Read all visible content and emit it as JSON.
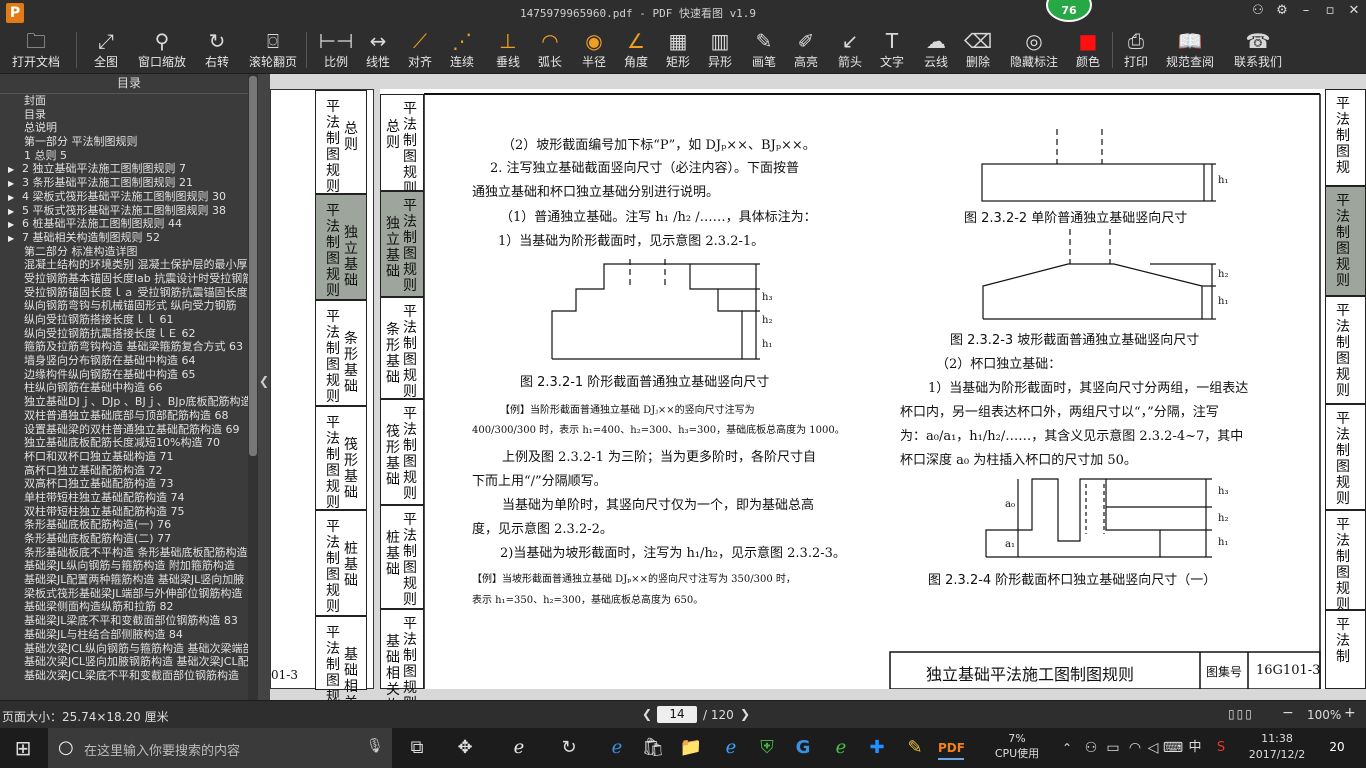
{
  "window": {
    "title": "1475979965960.pdf - PDF 快速看图 v1.9",
    "badge": "76",
    "logo": "P"
  },
  "toolbar": [
    {
      "label": "打开文档",
      "icon": "folder-icon"
    },
    {
      "label": "全图",
      "icon": "fullview-icon"
    },
    {
      "label": "窗口缩放",
      "icon": "zoom-icon"
    },
    {
      "label": "右转",
      "icon": "rotate-icon"
    },
    {
      "label": "滚轮翻页",
      "icon": "mouse-icon"
    },
    {
      "label": "比例",
      "icon": "scale-icon"
    },
    {
      "label": "线性",
      "icon": "linear-icon"
    },
    {
      "label": "对齐",
      "icon": "align-icon"
    },
    {
      "label": "连续",
      "icon": "continuous-icon"
    },
    {
      "label": "垂线",
      "icon": "perpendicular-icon"
    },
    {
      "label": "弧长",
      "icon": "arc-icon"
    },
    {
      "label": "半径",
      "icon": "radius-icon"
    },
    {
      "label": "角度",
      "icon": "angle-icon"
    },
    {
      "label": "矩形",
      "icon": "rectangle-icon"
    },
    {
      "label": "异形",
      "icon": "polygon-icon"
    },
    {
      "label": "画笔",
      "icon": "pen-icon"
    },
    {
      "label": "高亮",
      "icon": "highlight-icon"
    },
    {
      "label": "箭头",
      "icon": "arrow-icon"
    },
    {
      "label": "文字",
      "icon": "text-icon"
    },
    {
      "label": "云线",
      "icon": "cloud-icon"
    },
    {
      "label": "删除",
      "icon": "eraser-icon"
    },
    {
      "label": "隐藏标注",
      "icon": "eye-hide-icon"
    },
    {
      "label": "颜色",
      "icon": "color-icon"
    },
    {
      "label": "打印",
      "icon": "print-icon"
    },
    {
      "label": "规范查阅",
      "icon": "book-icon"
    },
    {
      "label": "联系我们",
      "icon": "contact-icon"
    }
  ],
  "sidebar": {
    "header": "目录",
    "items": [
      {
        "t": "封面",
        "l": 0,
        "a": false
      },
      {
        "t": "目录",
        "l": 0,
        "a": false
      },
      {
        "t": "总说明",
        "l": 0,
        "a": false
      },
      {
        "t": "第一部分  平法制图规则",
        "l": 0,
        "a": false
      },
      {
        "t": "1 总则 5",
        "l": 0,
        "a": false
      },
      {
        "t": "2 独立基础平法施工图制图规则 7",
        "l": 0,
        "a": true
      },
      {
        "t": "3 条形基础平法施工图制图规则 21",
        "l": 0,
        "a": true
      },
      {
        "t": "4 梁板式筏形基础平法施工图制图规则 30",
        "l": 0,
        "a": true
      },
      {
        "t": "5 平板式筏形基础平法施工图制图规则 38",
        "l": 0,
        "a": true
      },
      {
        "t": "6 桩基础平法施工图制图规则 44",
        "l": 0,
        "a": true
      },
      {
        "t": "7 基础相关构造制图规则 52",
        "l": 0,
        "a": true
      },
      {
        "t": "第二部分  标准构造详图",
        "l": 0,
        "a": false
      },
      {
        "t": "混凝土结构的环境类别 混凝土保护层的最小厚度",
        "l": 0,
        "a": false
      },
      {
        "t": "受拉钢筋基本锚固长度lab 抗震设计时受拉钢筋",
        "l": 0,
        "a": false
      },
      {
        "t": "受拉钢筋锚固长度ｌａ 受拉钢筋抗震锚固长度",
        "l": 0,
        "a": false
      },
      {
        "t": "纵向钢筋弯钩与机械锚固形式 纵向受力钢筋",
        "l": 0,
        "a": false
      },
      {
        "t": "纵向受拉钢筋搭接长度ｌｌ 61",
        "l": 0,
        "a": false
      },
      {
        "t": "纵向受拉钢筋抗震搭接长度ｌＥ 62",
        "l": 0,
        "a": false
      },
      {
        "t": "箍筋及拉筋弯钩构造 基础梁箍筋复合方式 63",
        "l": 0,
        "a": false
      },
      {
        "t": "墙身竖向分布钢筋在基础中构造 64",
        "l": 0,
        "a": false
      },
      {
        "t": "边缘构件纵向钢筋在基础中构造 65",
        "l": 0,
        "a": false
      },
      {
        "t": "柱纵向钢筋在基础中构造 66",
        "l": 0,
        "a": false
      },
      {
        "t": "独立基础DJｊ、DJp 、BJｊ、BJp底板配筋构造 67",
        "l": 0,
        "a": false
      },
      {
        "t": "双柱普通独立基础底部与顶部配筋构造 68",
        "l": 0,
        "a": false
      },
      {
        "t": "设置基础梁的双柱普通独立基础配筋构造 69",
        "l": 0,
        "a": false
      },
      {
        "t": "独立基础底板配筋长度减短10%构造 70",
        "l": 0,
        "a": false
      },
      {
        "t": "杯口和双杯口独立基础构造 71",
        "l": 0,
        "a": false
      },
      {
        "t": "高杯口独立基础配筋构造 72",
        "l": 0,
        "a": false
      },
      {
        "t": "双高杯口独立基础配筋构造 73",
        "l": 0,
        "a": false
      },
      {
        "t": "单柱带短柱独立基础配筋构造 74",
        "l": 0,
        "a": false
      },
      {
        "t": "双柱带短柱独立基础配筋构造 75",
        "l": 0,
        "a": false
      },
      {
        "t": "条形基础底板配筋构造(一) 76",
        "l": 0,
        "a": false
      },
      {
        "t": "条形基础底板配筋构造(二) 77",
        "l": 0,
        "a": false
      },
      {
        "t": "条形基础板底不平构造 条形基础底板配筋构造",
        "l": 0,
        "a": false
      },
      {
        "t": "基础梁JL纵向钢筋与箍筋构造 附加箍筋构造",
        "l": 0,
        "a": false
      },
      {
        "t": "基础梁JL配置两种箍筋构造 基础梁JL竖向加腋",
        "l": 0,
        "a": false
      },
      {
        "t": "梁板式筏形基础梁JL端部与外伸部位钢筋构造",
        "l": 0,
        "a": false
      },
      {
        "t": "基础梁侧面构造纵筋和拉筋 82",
        "l": 0,
        "a": false
      },
      {
        "t": "基础梁JL梁底不平和变截面部位钢筋构造 83",
        "l": 0,
        "a": false
      },
      {
        "t": "基础梁JL与柱结合部侧腋构造 84",
        "l": 0,
        "a": false
      },
      {
        "t": "基础次梁JCL纵向钢筋与箍筋构造 基础次梁端部",
        "l": 0,
        "a": false
      },
      {
        "t": "基础次梁JCL竖向加腋钢筋构造 基础次梁JCL配置",
        "l": 0,
        "a": false
      },
      {
        "t": "基础次梁JCL梁底不平和变截面部位钢筋构造",
        "l": 0,
        "a": false
      }
    ]
  },
  "leftpage_tabs": [
    {
      "chars": "平法制图规则",
      "side": "总则",
      "dark": false
    },
    {
      "chars": "平法制图规则",
      "side": "独立基础",
      "dark": true
    },
    {
      "chars": "平法制图规则",
      "side": "条形基础",
      "dark": false
    },
    {
      "chars": "平法制图规则",
      "side": "筏形基础",
      "dark": false
    },
    {
      "chars": "平法制图规则",
      "side": "桩基础",
      "dark": false
    },
    {
      "chars": "平法制图规则",
      "side": "基础相关构",
      "dark": false
    }
  ],
  "leftpage_footer": "01-3",
  "mainpage_tabs": [
    {
      "side": "总则",
      "chars": "平法制图规则",
      "dark": false
    },
    {
      "side": "独立基础",
      "chars": "平法制图规则",
      "dark": true
    },
    {
      "side": "条形基础",
      "chars": "平法制图规则",
      "dark": false
    },
    {
      "side": "筏形基础",
      "chars": "平法制图规则",
      "dark": false
    },
    {
      "side": "桩基础",
      "chars": "平法制图规则",
      "dark": false
    },
    {
      "side": "基础相关构造",
      "chars": "平法制图规则",
      "dark": false
    }
  ],
  "right_tabs": [
    {
      "chars": "平法制图规",
      "dark": false
    },
    {
      "chars": "平法制图规则",
      "dark": true
    },
    {
      "chars": "平法制图规则",
      "dark": false
    },
    {
      "chars": "平法制图规则",
      "dark": false
    },
    {
      "chars": "平法制图规则",
      "dark": false
    },
    {
      "chars": "平法制",
      "dark": false
    }
  ],
  "doc": {
    "l1": "（2）坡形截面编号加下标“P”，如 DJₚ××、BJₚ××。",
    "l2": "2. 注写独立基础截面竖向尺寸（必注内容）。下面按普",
    "l3": "通独立基础和杯口独立基础分别进行说明。",
    "l4": "（1）普通独立基础。注写 h₁ /h₂ /……，具体标注为：",
    "l5": "1）当基础为阶形截面时，见示意图 2.3.2-1。",
    "cap1": "图 2.3.2-1 阶形截面普通独立基础竖向尺寸",
    "ex1a": "【例】当阶形截面普通独立基础 DJⱼ××的竖向尺寸注写为",
    "ex1b": "400/300/300 时，表示 h₁=400、h₂=300、h₃=300，基础底板总高度为 1000。",
    "l6": "上例及图 2.3.2-1 为三阶；当为更多阶时，各阶尺寸自",
    "l7": "下而上用“/”分隔顺写。",
    "l8": "当基础为单阶时，其竖向尺寸仅为一个，即为基础总高",
    "l9": "度，见示意图 2.3.2-2。",
    "l10": "2)当基础为坡形截面时，注写为 h₁/h₂，见示意图 2.3.2-3。",
    "ex2a": "【例】当坡形截面普通独立基础 DJₚ××的竖向尺寸注写为 350/300 时，",
    "ex2b": "表示 h₁=350、h₂=300，基础底板总高度为 650。",
    "cap2": "图 2.3.2-2  单阶普通独立基础竖向尺寸",
    "cap3": "图 2.3.2-3  坡形截面普通独立基础竖向尺寸",
    "r1": "（2）杯口独立基础：",
    "r2": "1）当基础为阶形截面时，其竖向尺寸分两组，一组表达",
    "r3": "杯口内，另一组表达杯口外，两组尺寸以“，”分隔，注写",
    "r4": "为：a₀/a₁，h₁/h₂/……，其含义见示意图 2.3.2-4~7，其中",
    "r5": "杯口深度 a₀ 为柱插入杯口的尺寸加 50。",
    "cap4": "图 2.3.2-4  阶形截面杯口独立基础竖向尺寸（一）",
    "title_block": "独立基础平法施工图制图规则",
    "atlas_label": "图集号",
    "atlas_no": "16G101-3",
    "dims": {
      "h1": "h₁",
      "h2": "h₂",
      "h3": "h₃",
      "a0": "a₀",
      "a1": "a₁"
    }
  },
  "status": {
    "page_size": "页面大小：25.74×18.20 厘米",
    "page": "14",
    "total": "/ 120",
    "zoom": "100%"
  },
  "taskbar": {
    "search": "在这里输入你要搜索的内容",
    "cpu_pct": "7%",
    "cpu_label": "CPU使用",
    "ime": "中",
    "time": "11:38",
    "date": "2017/12/2",
    "notif": "20"
  }
}
